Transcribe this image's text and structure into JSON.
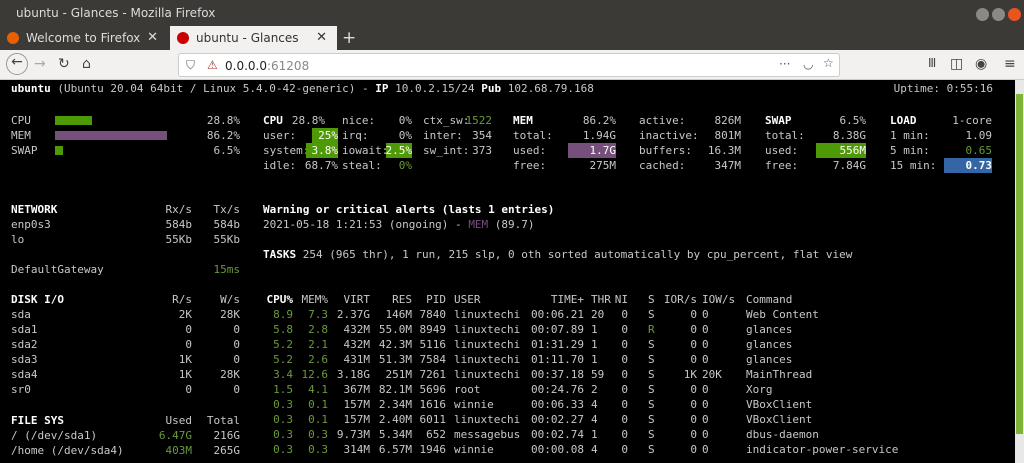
{
  "window": {
    "title": "ubuntu - Glances - Mozilla Firefox"
  },
  "tabs": [
    {
      "label": "Welcome to Firefox"
    },
    {
      "label": "ubuntu - Glances"
    }
  ],
  "url": {
    "host": "0.0.0.0",
    "port": ":61208"
  },
  "colors": {
    "green": "#4e9a06",
    "purple": "#75507b",
    "blue": "#3465a4"
  },
  "header": {
    "host": "ubuntu",
    "os": "(Ubuntu 20.04 64bit / Linux 5.4.0-42-generic) - ",
    "ip_label": "IP",
    "ip": " 10.0.2.15/24 ",
    "pub_label": "Pub",
    "pub": " 102.68.79.168",
    "uptime": "Uptime: 0:55:16"
  },
  "quicklook": [
    {
      "label": "CPU",
      "value": "28.8%",
      "pct": 28.8
    },
    {
      "label": "MEM",
      "value": "86.2%",
      "pct": 86.2
    },
    {
      "label": "SWAP",
      "value": "6.5%",
      "pct": 6.5
    }
  ],
  "cpu": {
    "title": "CPU",
    "total": "28.8%",
    "user": "25%",
    "system": "3.8%",
    "idle": "68.7%",
    "nice": "0%",
    "irq": "0%",
    "iowait": "2.5%",
    "steal": "0%",
    "ctx_sw": "1522",
    "inter": "354",
    "sw_int": "373"
  },
  "mem": {
    "title": "MEM",
    "pct": "86.2%",
    "total": "1.94G",
    "used": "1.7G",
    "free": "275M",
    "active": "826M",
    "inactive": "801M",
    "buffers": "16.3M",
    "cached": "347M"
  },
  "swap": {
    "title": "SWAP",
    "pct": "6.5%",
    "total": "8.38G",
    "used": "556M",
    "free": "7.84G"
  },
  "load": {
    "title": "LOAD",
    "cores": "1-core",
    "m1": "1.09",
    "m5": "0.65",
    "m15": "0.73"
  },
  "network": {
    "title": "NETWORK",
    "rx": "Rx/s",
    "tx": "Tx/s",
    "rows": [
      [
        "enp0s3",
        "584b",
        "584b"
      ],
      [
        "lo",
        "55Kb",
        "55Kb"
      ]
    ],
    "gateway": "DefaultGateway",
    "gateway_val": "15ms"
  },
  "disk": {
    "title": "DISK I/O",
    "r": "R/s",
    "w": "W/s",
    "rows": [
      [
        "sda",
        "2K",
        "28K"
      ],
      [
        "sda1",
        "0",
        "0"
      ],
      [
        "sda2",
        "0",
        "0"
      ],
      [
        "sda3",
        "1K",
        "0"
      ],
      [
        "sda4",
        "1K",
        "28K"
      ],
      [
        "sr0",
        "0",
        "0"
      ]
    ]
  },
  "fs": {
    "title": "FILE SYS",
    "used": "Used",
    "total": "Total",
    "rows": [
      [
        "/ (/dev/sda1)",
        "6.47G",
        "216G"
      ],
      [
        "/home (/dev/sda4)",
        "403M",
        "265G"
      ]
    ]
  },
  "alerts": {
    "title": "Warning or critical alerts (lasts 1 entries)",
    "entry": "2021-05-18 1:21:53 (ongoing) - ",
    "type": "MEM",
    "val": " (89.7)"
  },
  "tasks": {
    "label": "TASKS",
    "text": " 254 (965 thr), 1 run, 215 slp, 0 oth sorted automatically by cpu_percent, flat view"
  },
  "processes": {
    "headers": [
      "CPU%",
      "MEM%",
      "VIRT",
      "RES",
      "PID",
      "USER",
      "TIME+",
      "THR",
      "NI",
      "S",
      "IOR/s",
      "IOW/s",
      "Command"
    ],
    "rows": [
      [
        "8.9",
        "7.3",
        "2.37G",
        "146M",
        "7840",
        "linuxtechi",
        "00:06.21",
        "20",
        "0",
        "S",
        "0",
        "0",
        "Web Content"
      ],
      [
        "5.8",
        "2.8",
        "432M",
        "55.0M",
        "8949",
        "linuxtechi",
        "00:07.89",
        "1",
        "0",
        "R",
        "0",
        "0",
        "glances"
      ],
      [
        "5.2",
        "2.1",
        "432M",
        "42.3M",
        "5116",
        "linuxtechi",
        "01:31.29",
        "1",
        "0",
        "S",
        "0",
        "0",
        "glances"
      ],
      [
        "5.2",
        "2.6",
        "431M",
        "51.3M",
        "7584",
        "linuxtechi",
        "01:11.70",
        "1",
        "0",
        "S",
        "0",
        "0",
        "glances"
      ],
      [
        "3.4",
        "12.6",
        "3.18G",
        "251M",
        "7261",
        "linuxtechi",
        "00:37.18",
        "59",
        "0",
        "S",
        "1K",
        "20K",
        "MainThread"
      ],
      [
        "1.5",
        "4.1",
        "367M",
        "82.1M",
        "5696",
        "root",
        "00:24.76",
        "2",
        "0",
        "S",
        "0",
        "0",
        "Xorg"
      ],
      [
        "0.3",
        "0.1",
        "157M",
        "2.34M",
        "1616",
        "winnie",
        "00:06.33",
        "4",
        "0",
        "S",
        "0",
        "0",
        "VBoxClient"
      ],
      [
        "0.3",
        "0.1",
        "157M",
        "2.40M",
        "6011",
        "linuxtechi",
        "00:02.27",
        "4",
        "0",
        "S",
        "0",
        "0",
        "VBoxClient"
      ],
      [
        "0.3",
        "0.3",
        "9.73M",
        "5.34M",
        "652",
        "messagebus",
        "00:02.74",
        "1",
        "0",
        "S",
        "0",
        "0",
        "dbus-daemon"
      ],
      [
        "0.3",
        "0.3",
        "314M",
        "6.57M",
        "1946",
        "winnie",
        "00:00.08",
        "4",
        "0",
        "S",
        "0",
        "0",
        "indicator-power-service"
      ]
    ]
  }
}
